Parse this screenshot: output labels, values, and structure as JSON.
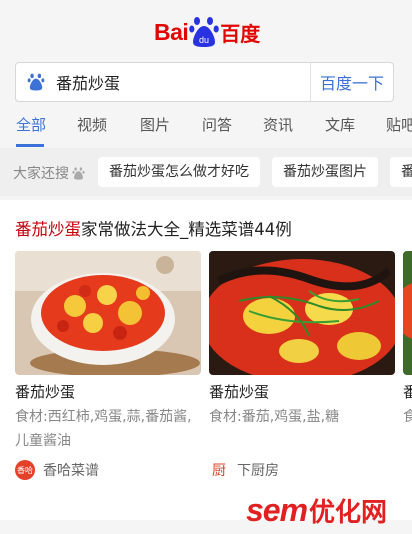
{
  "logo": {
    "bai": "Bai",
    "du": "du",
    "cn": "百度"
  },
  "search": {
    "value": "番茄炒蛋",
    "button": "百度一下"
  },
  "tabs": [
    "全部",
    "视频",
    "图片",
    "问答",
    "资讯",
    "文库",
    "贴吧"
  ],
  "related": {
    "label": "大家还搜",
    "chips": [
      "番茄炒蛋怎么做才好吃",
      "番茄炒蛋图片",
      "番茄"
    ]
  },
  "result": {
    "title_highlight": "番茄炒蛋",
    "title_rest": "家常做法大全_精选菜谱44例",
    "items": [
      {
        "name": "番茄炒蛋",
        "ingredients": "食材:西红柿,鸡蛋,蒜,番茄酱,儿童酱油",
        "source": "香哈菜谱",
        "source_logo": "香哈"
      },
      {
        "name": "番茄炒蛋",
        "ingredients": "食材:番茄,鸡蛋,盐,糖",
        "source": "下厨房",
        "source_logo": "厨"
      },
      {
        "name": "番",
        "ingredients": "食盐",
        "source": "",
        "source_logo": ""
      }
    ]
  },
  "watermark": {
    "latin": "sem",
    "cn": "优化网"
  },
  "colors": {
    "accent": "#3c72d8",
    "brand_red": "#e10602",
    "highlight": "#c7000b"
  }
}
